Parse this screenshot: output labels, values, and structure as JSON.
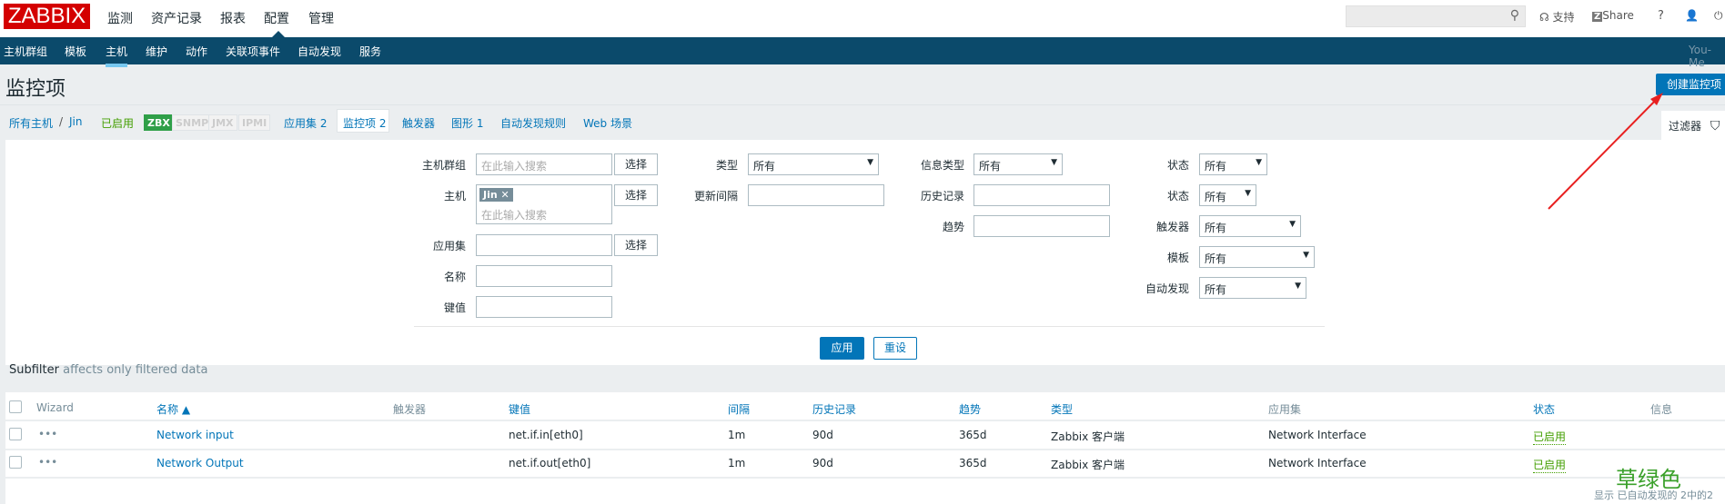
{
  "logo": "ZABBIX",
  "main_menu": [
    "监测",
    "资产记录",
    "报表",
    "配置",
    "管理"
  ],
  "sub_menu": [
    "主机群组",
    "模板",
    "主机",
    "维护",
    "动作",
    "关联项事件",
    "自动发现",
    "服务"
  ],
  "header_tools": {
    "support": "支持",
    "share": "Share",
    "help": "?",
    "server_name": "You-Me"
  },
  "page_title": "监控项",
  "create_button": "创建监控项",
  "breadcrumb": {
    "all_hosts": "所有主机",
    "sep": "/",
    "host": "Jin",
    "status": "已启用"
  },
  "availability": [
    "ZBX",
    "SNMP",
    "JMX",
    "IPMI"
  ],
  "tabs": [
    "应用集 2",
    "监控项 2",
    "触发器",
    "图形 1",
    "自动发现规则",
    "Web 场景"
  ],
  "filter_label": "过滤器",
  "filter": {
    "host_group": {
      "label": "主机群组",
      "placeholder": "在此输入搜索"
    },
    "host": {
      "label": "主机",
      "tag": "Jin",
      "placeholder": "在此输入搜索"
    },
    "application": {
      "label": "应用集"
    },
    "name": {
      "label": "名称"
    },
    "key": {
      "label": "键值"
    },
    "select": "选择",
    "type": {
      "label": "类型",
      "value": "所有"
    },
    "update_interval": {
      "label": "更新间隔"
    },
    "info_type": {
      "label": "信息类型",
      "value": "所有"
    },
    "history": {
      "label": "历史记录"
    },
    "trends": {
      "label": "趋势"
    },
    "state": {
      "label": "状态",
      "value": "所有"
    },
    "status": {
      "label": "状态",
      "value": "所有"
    },
    "triggers": {
      "label": "触发器",
      "value": "所有"
    },
    "template": {
      "label": "模板",
      "value": "所有"
    },
    "discovery": {
      "label": "自动发现",
      "value": "所有"
    },
    "apply": "应用",
    "reset": "重设"
  },
  "subfilter": {
    "title": "Subfilter",
    "note": "affects only filtered data"
  },
  "table": {
    "headers": [
      "Wizard",
      "名称 ▲",
      "触发器",
      "键值",
      "间隔",
      "历史记录",
      "趋势",
      "类型",
      "应用集",
      "状态",
      "信息"
    ],
    "rows": [
      {
        "wizard": "•••",
        "name": "Network input",
        "key": "net.if.in[eth0]",
        "interval": "1m",
        "history": "90d",
        "trends": "365d",
        "type": "Zabbix 客户端",
        "app": "Network Interface",
        "status": "已启用"
      },
      {
        "wizard": "•••",
        "name": "Network Output",
        "key": "net.if.out[eth0]",
        "interval": "1m",
        "history": "90d",
        "trends": "365d",
        "type": "Zabbix 客户端",
        "app": "Network Interface",
        "status": "已启用"
      }
    ]
  },
  "annotation": "草绿色",
  "footer": "显示 已自动发现的 2中的2"
}
